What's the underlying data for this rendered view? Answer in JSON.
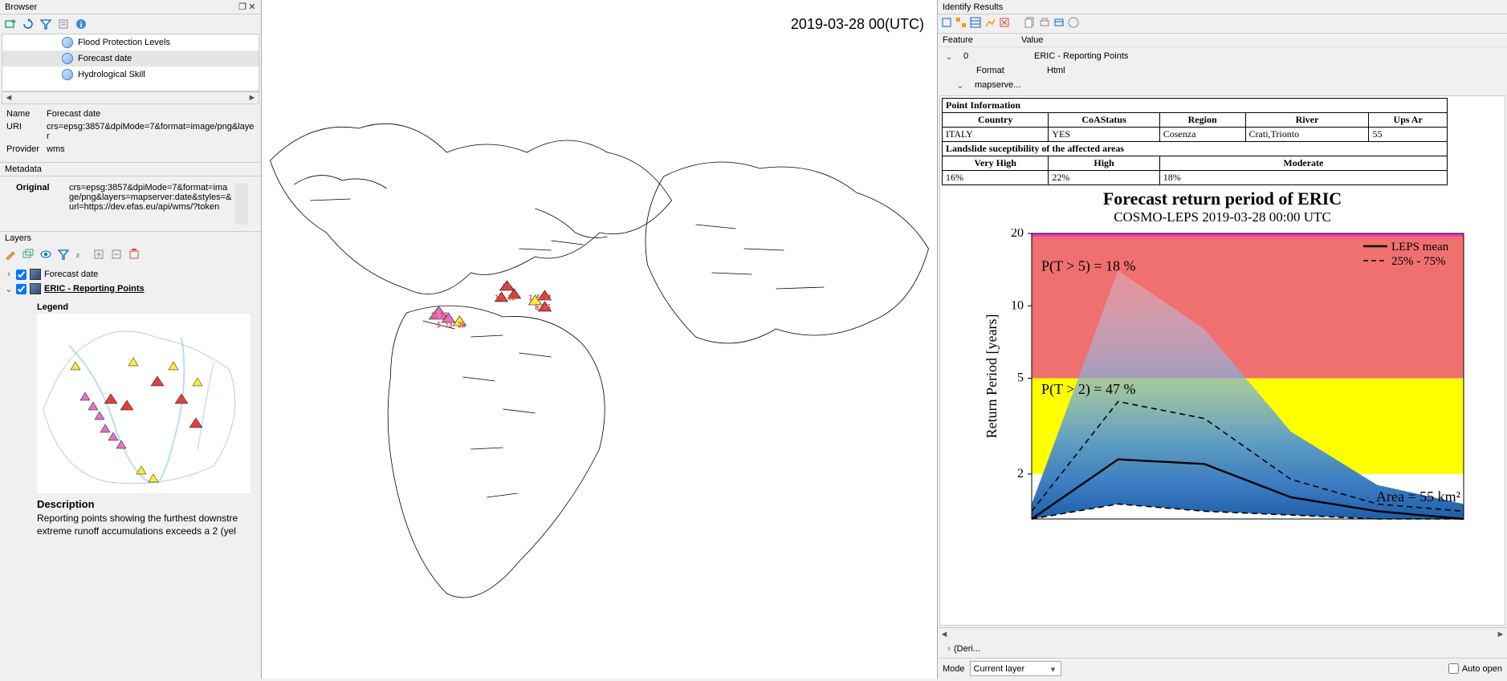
{
  "browser": {
    "title": "Browser",
    "items": [
      {
        "label": "Flood Protection Levels",
        "selected": false
      },
      {
        "label": "Forecast date",
        "selected": true
      },
      {
        "label": "Hydrological Skill",
        "selected": false
      }
    ],
    "props": {
      "name_label": "Name",
      "name": "Forecast date",
      "uri_label": "URI",
      "uri": "crs=epsg:3857&dpiMode=7&format=image/png&layer",
      "provider_label": "Provider",
      "provider": "wms"
    },
    "metadata_label": "Metadata",
    "metadata": {
      "original_label": "Original",
      "original": "crs=epsg:3857&dpiMode=7&format=image/png&layers=mapserver:date&styles=&url=https://dev.efas.eu/api/wms/?token"
    }
  },
  "layers": {
    "title": "Layers",
    "items": [
      {
        "label": "Forecast date",
        "checked": true,
        "selected": false
      },
      {
        "label": "ERIC - Reporting Points",
        "checked": true,
        "selected": true
      }
    ],
    "legend_label": "Legend",
    "desc_label": "Description",
    "desc_text": "Reporting points showing the furthest downstre extreme runoff accumulations exceeds a 2 (yel"
  },
  "map": {
    "timestamp": "2019-03-28 00(UTC)"
  },
  "identify": {
    "title": "Identify Results",
    "header_feature": "Feature",
    "header_value": "Value",
    "root_index": "0",
    "root_value": "ERIC - Reporting Points",
    "format_label": "Format",
    "format_value": "Html",
    "node": "mapserve...",
    "deri": "(Deri...",
    "mode_label": "Mode",
    "mode_value": "Current layer",
    "auto_open": "Auto open"
  },
  "point_info": {
    "title": "Point Information",
    "headers": [
      "Country",
      "CoAStatus",
      "Region",
      "River",
      "Ups Ar"
    ],
    "values": [
      "ITALY",
      "YES",
      "Cosenza",
      "Crati,Trionto",
      "55"
    ],
    "suscept_title": "Landslide suceptibility of the affected areas",
    "suscept_headers": [
      "Very High",
      "High",
      "Moderate"
    ],
    "suscept_values": [
      "16%",
      "22%",
      "18%"
    ]
  },
  "chart_data": {
    "type": "line",
    "title": "Forecast return period of ERIC",
    "subtitle": "COSMO-LEPS 2019-03-28 00:00 UTC",
    "ylabel": "Return Period [years]",
    "yticks": [
      2,
      5,
      10,
      20
    ],
    "ylim": [
      1.3,
      20
    ],
    "x": [
      0,
      1,
      2,
      3,
      4,
      5
    ],
    "series": [
      {
        "name": "LEPS mean",
        "style": "solid",
        "values": [
          1.3,
          2.3,
          2.2,
          1.6,
          1.4,
          1.3
        ]
      },
      {
        "name": "25% - 75%",
        "style": "dashed_low",
        "values": [
          1.3,
          1.5,
          1.4,
          1.35,
          1.3,
          1.3
        ]
      },
      {
        "name": "25% - 75% upper",
        "style": "dashed_high",
        "values": [
          1.4,
          4.0,
          3.4,
          1.9,
          1.5,
          1.4
        ]
      }
    ],
    "fan_max": [
      1.5,
      14,
      8,
      3,
      1.8,
      1.5
    ],
    "bands": [
      {
        "from": 2,
        "to": 5,
        "color": "#ffff00"
      },
      {
        "from": 5,
        "to": 20,
        "color": "#f07070"
      }
    ],
    "annotations": [
      {
        "text": "P(T > 5) = 18 %",
        "y": 15,
        "yval_approx": true
      },
      {
        "text": "P(T > 2) = 47 %",
        "y": 4.5
      }
    ],
    "legend": [
      "LEPS mean",
      "25% - 75%"
    ],
    "area_label": "Area = 55 km²"
  }
}
